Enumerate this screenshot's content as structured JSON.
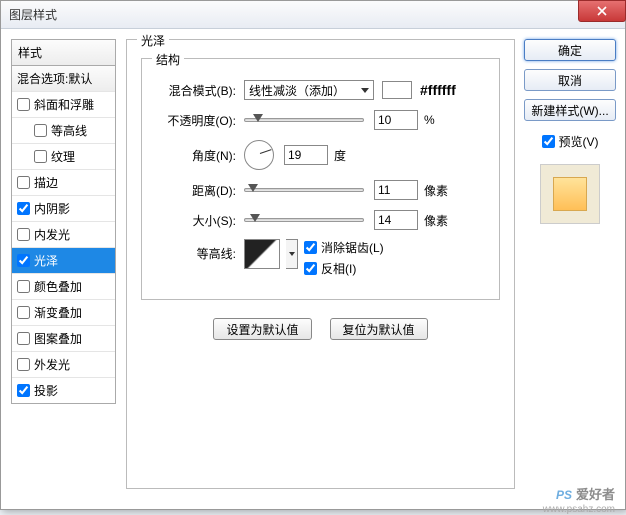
{
  "window": {
    "title": "图层样式"
  },
  "sidebar": {
    "header": "样式",
    "items": [
      {
        "label": "混合选项:默认",
        "type": "blend"
      },
      {
        "label": "斜面和浮雕",
        "checked": false,
        "indent": 0
      },
      {
        "label": "等高线",
        "checked": false,
        "indent": 1
      },
      {
        "label": "纹理",
        "checked": false,
        "indent": 1
      },
      {
        "label": "描边",
        "checked": false,
        "indent": 0
      },
      {
        "label": "内阴影",
        "checked": true,
        "indent": 0
      },
      {
        "label": "内发光",
        "checked": false,
        "indent": 0
      },
      {
        "label": "光泽",
        "checked": true,
        "indent": 0,
        "selected": true
      },
      {
        "label": "颜色叠加",
        "checked": false,
        "indent": 0
      },
      {
        "label": "渐变叠加",
        "checked": false,
        "indent": 0
      },
      {
        "label": "图案叠加",
        "checked": false,
        "indent": 0
      },
      {
        "label": "外发光",
        "checked": false,
        "indent": 0
      },
      {
        "label": "投影",
        "checked": true,
        "indent": 0
      }
    ]
  },
  "panel": {
    "title": "光泽",
    "group": "结构",
    "blend_label": "混合模式(B):",
    "blend_value": "线性减淡（添加）",
    "color_hex": "#ffffff",
    "opacity_label": "不透明度(O):",
    "opacity_value": "10",
    "opacity_unit": "%",
    "angle_label": "角度(N):",
    "angle_value": "19",
    "angle_unit": "度",
    "distance_label": "距离(D):",
    "distance_value": "11",
    "distance_unit": "像素",
    "size_label": "大小(S):",
    "size_value": "14",
    "size_unit": "像素",
    "contour_label": "等高线:",
    "antialias_label": "消除锯齿(L)",
    "invert_label": "反相(I)",
    "set_default": "设置为默认值",
    "reset_default": "复位为默认值"
  },
  "right": {
    "ok": "确定",
    "cancel": "取消",
    "new_style": "新建样式(W)...",
    "preview": "预览(V)"
  },
  "watermark": {
    "logo": "PS",
    "text": "爱好者",
    "url": "www.psahz.com"
  }
}
